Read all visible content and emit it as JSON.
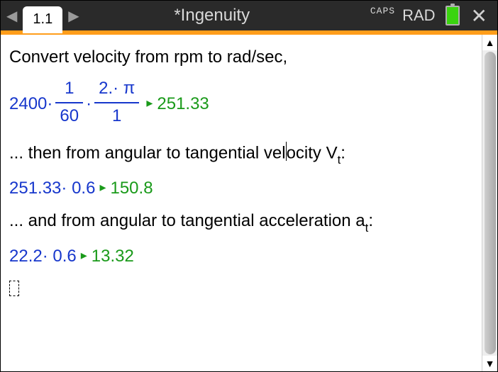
{
  "header": {
    "tab_label": "1.1",
    "title": "*Ingenuity",
    "caps": "CAPS",
    "angle_mode": "RAD"
  },
  "lines": {
    "comment1": "Convert velocity from rpm to rad/sec,",
    "expr1_a": "2400·",
    "expr1_frac1_num": "1",
    "expr1_frac1_den": "60",
    "expr1_mid": "·",
    "expr1_frac2_num": "2.· π",
    "expr1_frac2_den": "1",
    "result1": "251.33",
    "comment2_a": "... then from angular to tangential vel",
    "comment2_b": "ocity V",
    "comment2_sub": "t",
    "comment2_c": ":",
    "expr2": "251.33· 0.6",
    "result2": "150.8",
    "comment3_a": "... and from angular to tangential acceleration a",
    "comment3_sub": "t",
    "comment3_b": ":",
    "expr3": "22.2· 0.6",
    "result3": "13.32"
  },
  "glyphs": {
    "result_arrow": "▸"
  }
}
